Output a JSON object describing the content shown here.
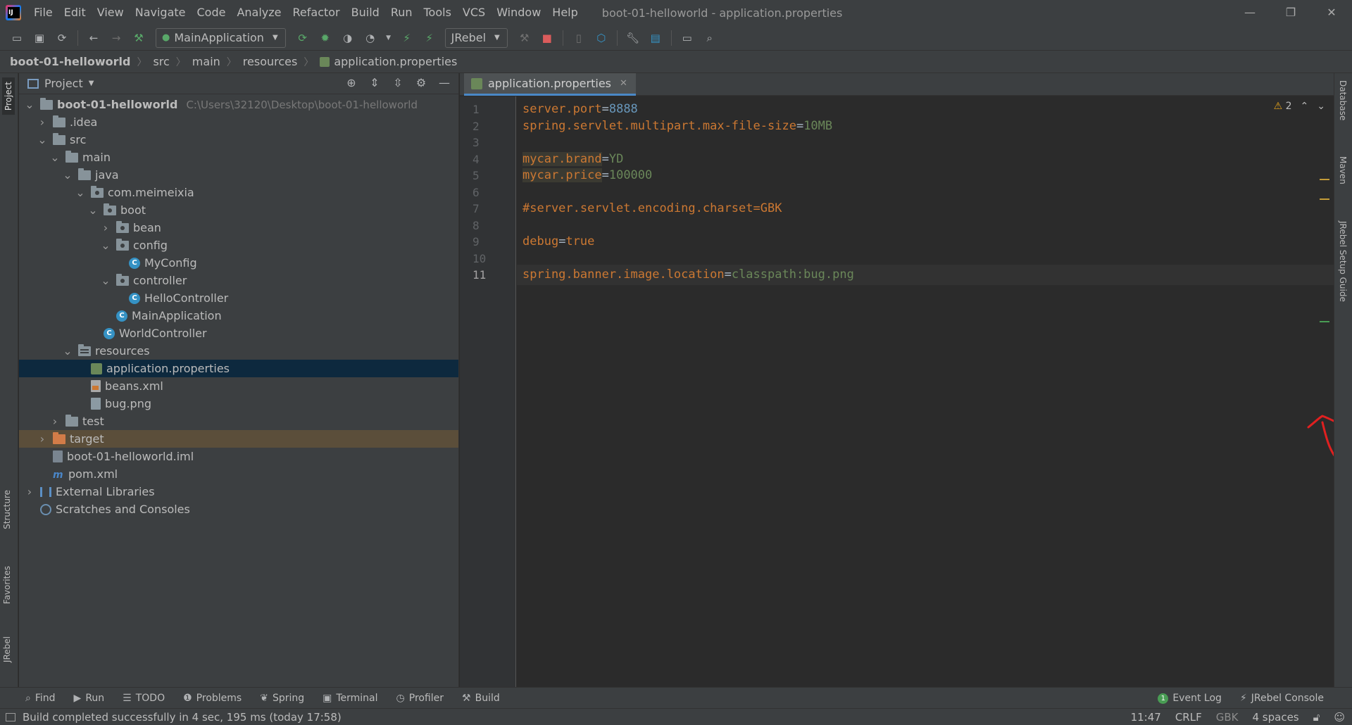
{
  "menu": {
    "items": [
      "File",
      "Edit",
      "View",
      "Navigate",
      "Code",
      "Analyze",
      "Refactor",
      "Build",
      "Run",
      "Tools",
      "VCS",
      "Window",
      "Help"
    ],
    "window_title": "boot-01-helloworld - application.properties"
  },
  "toolbar": {
    "run_config": "MainApplication",
    "jrebel_config": "JRebel"
  },
  "breadcrumbs": [
    "boot-01-helloworld",
    "src",
    "main",
    "resources",
    "application.properties"
  ],
  "left_strip": {
    "project": "Project",
    "structure": "Structure",
    "favorites": "Favorites",
    "jrebel": "JRebel"
  },
  "right_strip": {
    "database": "Database",
    "maven": "Maven",
    "jrebel_guide": "JRebel Setup Guide"
  },
  "project_panel": {
    "title": "Project",
    "tree": [
      {
        "label": "boot-01-helloworld",
        "path": "C:\\Users\\32120\\Desktop\\boot-01-helloworld",
        "depth": 0,
        "arrow": "down",
        "icon": "module-folder",
        "bold": true
      },
      {
        "label": ".idea",
        "depth": 1,
        "arrow": "right",
        "icon": "folder"
      },
      {
        "label": "src",
        "depth": 1,
        "arrow": "down",
        "icon": "folder"
      },
      {
        "label": "main",
        "depth": 2,
        "arrow": "down",
        "icon": "folder"
      },
      {
        "label": "java",
        "depth": 3,
        "arrow": "down",
        "icon": "source-folder"
      },
      {
        "label": "com.meimeixia",
        "depth": 4,
        "arrow": "down",
        "icon": "package"
      },
      {
        "label": "boot",
        "depth": 5,
        "arrow": "down",
        "icon": "package"
      },
      {
        "label": "bean",
        "depth": 6,
        "arrow": "right",
        "icon": "package"
      },
      {
        "label": "config",
        "depth": 6,
        "arrow": "down",
        "icon": "package"
      },
      {
        "label": "MyConfig",
        "depth": 7,
        "arrow": "none",
        "icon": "class"
      },
      {
        "label": "controller",
        "depth": 6,
        "arrow": "down",
        "icon": "package"
      },
      {
        "label": "HelloController",
        "depth": 7,
        "arrow": "none",
        "icon": "class"
      },
      {
        "label": "MainApplication",
        "depth": 6,
        "arrow": "none",
        "icon": "spring-class"
      },
      {
        "label": "WorldController",
        "depth": 5,
        "arrow": "none",
        "icon": "class"
      },
      {
        "label": "resources",
        "depth": 3,
        "arrow": "down",
        "icon": "resources-folder"
      },
      {
        "label": "application.properties",
        "depth": 4,
        "arrow": "none",
        "icon": "properties-file",
        "selected": true
      },
      {
        "label": "beans.xml",
        "depth": 4,
        "arrow": "none",
        "icon": "xml-file"
      },
      {
        "label": "bug.png",
        "depth": 4,
        "arrow": "none",
        "icon": "png-file"
      },
      {
        "label": "test",
        "depth": 2,
        "arrow": "right",
        "icon": "folder"
      },
      {
        "label": "target",
        "depth": 1,
        "arrow": "right",
        "icon": "excluded-folder",
        "excluded": true
      },
      {
        "label": "boot-01-helloworld.iml",
        "depth": 1,
        "arrow": "none",
        "icon": "iml-file"
      },
      {
        "label": "pom.xml",
        "depth": 1,
        "arrow": "none",
        "icon": "maven-file"
      },
      {
        "label": "External Libraries",
        "depth": 0,
        "arrow": "right",
        "icon": "libraries"
      },
      {
        "label": "Scratches and Consoles",
        "depth": 0,
        "arrow": "none",
        "icon": "scratches"
      }
    ]
  },
  "editor": {
    "tab_label": "application.properties",
    "warning_count": "2",
    "lines": [
      {
        "n": "1",
        "key": "server.port",
        "value": "8888",
        "type": "number"
      },
      {
        "n": "2",
        "key": "spring.servlet.multipart.max-file-size",
        "value": "10MB",
        "type": "string"
      },
      {
        "n": "3",
        "key": "",
        "value": "",
        "type": "empty"
      },
      {
        "n": "4",
        "key": "mycar.brand",
        "value": "YD",
        "type": "string",
        "highlight": true
      },
      {
        "n": "5",
        "key": "mycar.price",
        "value": "100000",
        "type": "string",
        "highlight": true
      },
      {
        "n": "6",
        "key": "",
        "value": "",
        "type": "empty"
      },
      {
        "n": "7",
        "key": "#server.servlet.encoding.charset=GBK",
        "value": "",
        "type": "comment"
      },
      {
        "n": "8",
        "key": "",
        "value": "",
        "type": "empty"
      },
      {
        "n": "9",
        "key": "debug",
        "value": "true",
        "type": "keyword"
      },
      {
        "n": "10",
        "key": "",
        "value": "",
        "type": "empty"
      },
      {
        "n": "11",
        "key": "spring.banner.image.location",
        "value": "classpath:bug.png",
        "type": "string",
        "current": true
      }
    ]
  },
  "bottom_tools": {
    "left": [
      "Find",
      "Run",
      "TODO",
      "Problems",
      "Spring",
      "Terminal",
      "Profiler",
      "Build"
    ],
    "event_log": "Event Log",
    "event_log_count": "1",
    "jrebel_console": "JRebel Console"
  },
  "status": {
    "message": "Build completed successfully in 4 sec, 195 ms (today 17:58)",
    "position": "11:47",
    "line_ending": "CRLF",
    "encoding": "GBK",
    "indent": "4 spaces"
  },
  "annotation_color": "#e02020"
}
